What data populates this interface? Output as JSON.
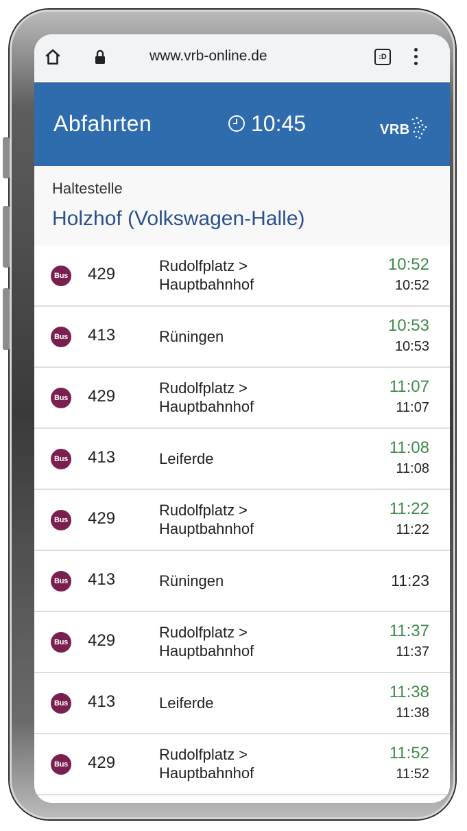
{
  "browser": {
    "url": "www.vrb-online.de",
    "home_icon": "home-icon",
    "lock_icon": "lock-icon",
    "tabs_label": ":D",
    "menu_icon": "more-vert-icon"
  },
  "header": {
    "title": "Abfahrten",
    "clock_icon": "clock-icon",
    "time": "10:45",
    "logo_text": "VRB",
    "bg_color": "#2f6cad"
  },
  "stop": {
    "label": "Haltestelle",
    "name": "Holzhof (Volkswagen-Halle)"
  },
  "departures": [
    {
      "badge": "Bus",
      "line": "429",
      "dest1": "Rudolfplatz >",
      "dest2": "Hauptbahnhof",
      "realtime": "10:52",
      "scheduled": "10:52"
    },
    {
      "badge": "Bus",
      "line": "413",
      "dest1": "Rüningen",
      "dest2": "",
      "realtime": "10:53",
      "scheduled": "10:53"
    },
    {
      "badge": "Bus",
      "line": "429",
      "dest1": "Rudolfplatz >",
      "dest2": "Hauptbahnhof",
      "realtime": "11:07",
      "scheduled": "11:07"
    },
    {
      "badge": "Bus",
      "line": "413",
      "dest1": "Leiferde",
      "dest2": "",
      "realtime": "11:08",
      "scheduled": "11:08"
    },
    {
      "badge": "Bus",
      "line": "429",
      "dest1": "Rudolfplatz >",
      "dest2": "Hauptbahnhof",
      "realtime": "11:22",
      "scheduled": "11:22"
    },
    {
      "badge": "Bus",
      "line": "413",
      "dest1": "Rüningen",
      "dest2": "",
      "realtime": "",
      "scheduled": "11:23"
    },
    {
      "badge": "Bus",
      "line": "429",
      "dest1": "Rudolfplatz >",
      "dest2": "Hauptbahnhof",
      "realtime": "11:37",
      "scheduled": "11:37"
    },
    {
      "badge": "Bus",
      "line": "413",
      "dest1": "Leiferde",
      "dest2": "",
      "realtime": "11:38",
      "scheduled": "11:38"
    },
    {
      "badge": "Bus",
      "line": "429",
      "dest1": "Rudolfplatz >",
      "dest2": "Hauptbahnhof",
      "realtime": "11:52",
      "scheduled": "11:52"
    }
  ],
  "colors": {
    "realtime": "#3f8b4a",
    "bus_badge": "#7a2050",
    "stop_name": "#2b4f8f"
  }
}
